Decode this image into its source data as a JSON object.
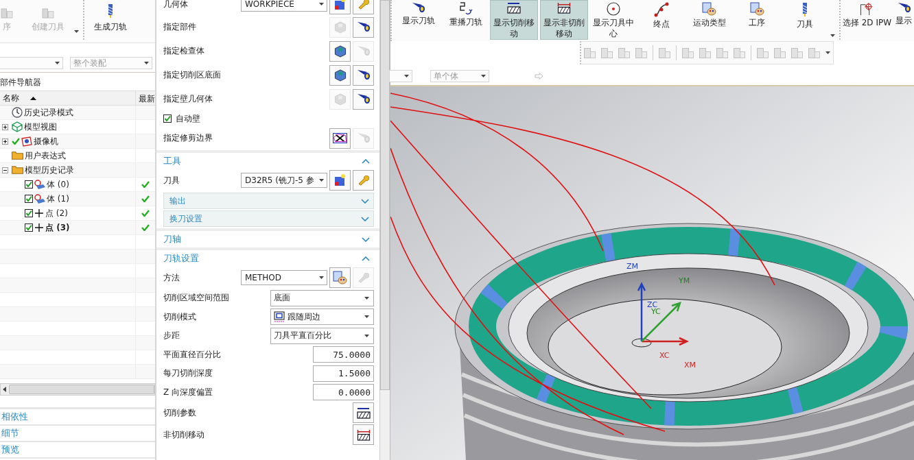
{
  "toolbar_left": {
    "buttons": [
      {
        "label": "序",
        "disabled": true
      },
      {
        "label": "创建刀具",
        "disabled": true
      },
      {
        "label": "生成刀轨",
        "disabled": false
      }
    ]
  },
  "filters_left": [
    {
      "disabled": true
    },
    {
      "value": "整个装配",
      "disabled": true
    }
  ],
  "part_navigator": {
    "title": "部件导航器",
    "columns": [
      "名称",
      "最新"
    ],
    "items": [
      {
        "label": "历史记录模式"
      },
      {
        "label": "模型视图",
        "expanded": false
      },
      {
        "label": "摄像机",
        "expanded": false,
        "checked": true
      },
      {
        "label": "用户表达式"
      },
      {
        "label": "模型历史记录",
        "expanded": true,
        "children": [
          {
            "label": "体 (0)",
            "checked": true,
            "latest": true,
            "current": false
          },
          {
            "label": "体 (1)",
            "checked": true,
            "latest": true,
            "current": false
          },
          {
            "label": "点 (2)",
            "checked": true,
            "latest": true,
            "current": false
          },
          {
            "label": "点 (3)",
            "checked": true,
            "latest": true,
            "current": true
          }
        ]
      }
    ]
  },
  "bottom_panels": [
    "相依性",
    "细节",
    "预览"
  ],
  "dialog": {
    "rows": [
      {
        "kind": "select",
        "label": "几何体",
        "value": "WORKPIECE",
        "buttons": [
          {
            "disabled": false
          },
          {
            "disabled": false
          }
        ]
      },
      {
        "kind": "pick",
        "label": "指定部件",
        "buttons": [
          {
            "disabled": true
          },
          {
            "disabled": false
          }
        ]
      },
      {
        "kind": "pick",
        "label": "指定检查体",
        "buttons": [
          {
            "disabled": false
          },
          {
            "disabled": true
          }
        ]
      },
      {
        "kind": "pick",
        "label": "指定切削区底面",
        "buttons": [
          {
            "disabled": false
          },
          {
            "disabled": false
          }
        ]
      },
      {
        "kind": "pick",
        "label": "指定壁几何体",
        "buttons": [
          {
            "disabled": true
          },
          {
            "disabled": false
          }
        ]
      },
      {
        "kind": "checkbox",
        "label": "自动壁",
        "checked": true
      },
      {
        "kind": "pick",
        "label": "指定修剪边界",
        "buttons": [
          {
            "disabled": false
          },
          {
            "disabled": true
          }
        ]
      },
      {
        "kind": "section",
        "label": "工具",
        "expanded": true
      },
      {
        "kind": "select",
        "label": "刀具",
        "value": "D32R5 (铣刀-5 参",
        "buttons": [
          {
            "disabled": false
          },
          {
            "disabled": false
          }
        ]
      },
      {
        "kind": "subsection",
        "label": "输出",
        "expanded": false
      },
      {
        "kind": "subsection",
        "label": "换刀设置",
        "expanded": false
      },
      {
        "kind": "section",
        "label": "刀轴",
        "expanded": false
      },
      {
        "kind": "section",
        "label": "刀轨设置",
        "expanded": true
      },
      {
        "kind": "select",
        "label": "方法",
        "value": "METHOD",
        "buttons": [
          {
            "disabled": false
          },
          {
            "disabled": true
          }
        ]
      },
      {
        "kind": "wide-select",
        "label": "切削区域空间范围",
        "value": "底面"
      },
      {
        "kind": "pattern-select",
        "label": "切削模式",
        "value": "跟随周边"
      },
      {
        "kind": "wide-select",
        "label": "步距",
        "value": "刀具平直百分比"
      },
      {
        "kind": "number",
        "label": "平面直径百分比",
        "value": "75.0000"
      },
      {
        "kind": "number",
        "label": "每刀切削深度",
        "value": "1.5000"
      },
      {
        "kind": "number",
        "label": "Z 向深度偏置",
        "value": "0.0000"
      },
      {
        "kind": "action",
        "label": "切削参数"
      },
      {
        "kind": "action",
        "label": "非切削移动"
      }
    ]
  },
  "toolbar_right": {
    "buttons": [
      {
        "label": "显示刀轨",
        "selected": false
      },
      {
        "label": "重播刀轨",
        "selected": false
      },
      {
        "label": "显示切削移动",
        "selected": true
      },
      {
        "label": "显示非切削移动",
        "selected": true
      },
      {
        "label": "显示刀具中心",
        "selected": false
      },
      {
        "label": "终点",
        "selected": false
      },
      {
        "label": "运动类型",
        "selected": false
      },
      {
        "label": "工序",
        "selected": false
      },
      {
        "label": "刀具",
        "selected": false
      }
    ],
    "extra_buttons": [
      {
        "label": "选择 2D IPW"
      },
      {
        "label": "显示"
      }
    ]
  },
  "filters_right": [
    {
      "disabled": true
    },
    {
      "value": "单个体",
      "disabled": true
    }
  ],
  "viewport": {
    "axis_labels": [
      "ZM",
      "ZC",
      "YM",
      "YC",
      "XC",
      "XM"
    ]
  }
}
